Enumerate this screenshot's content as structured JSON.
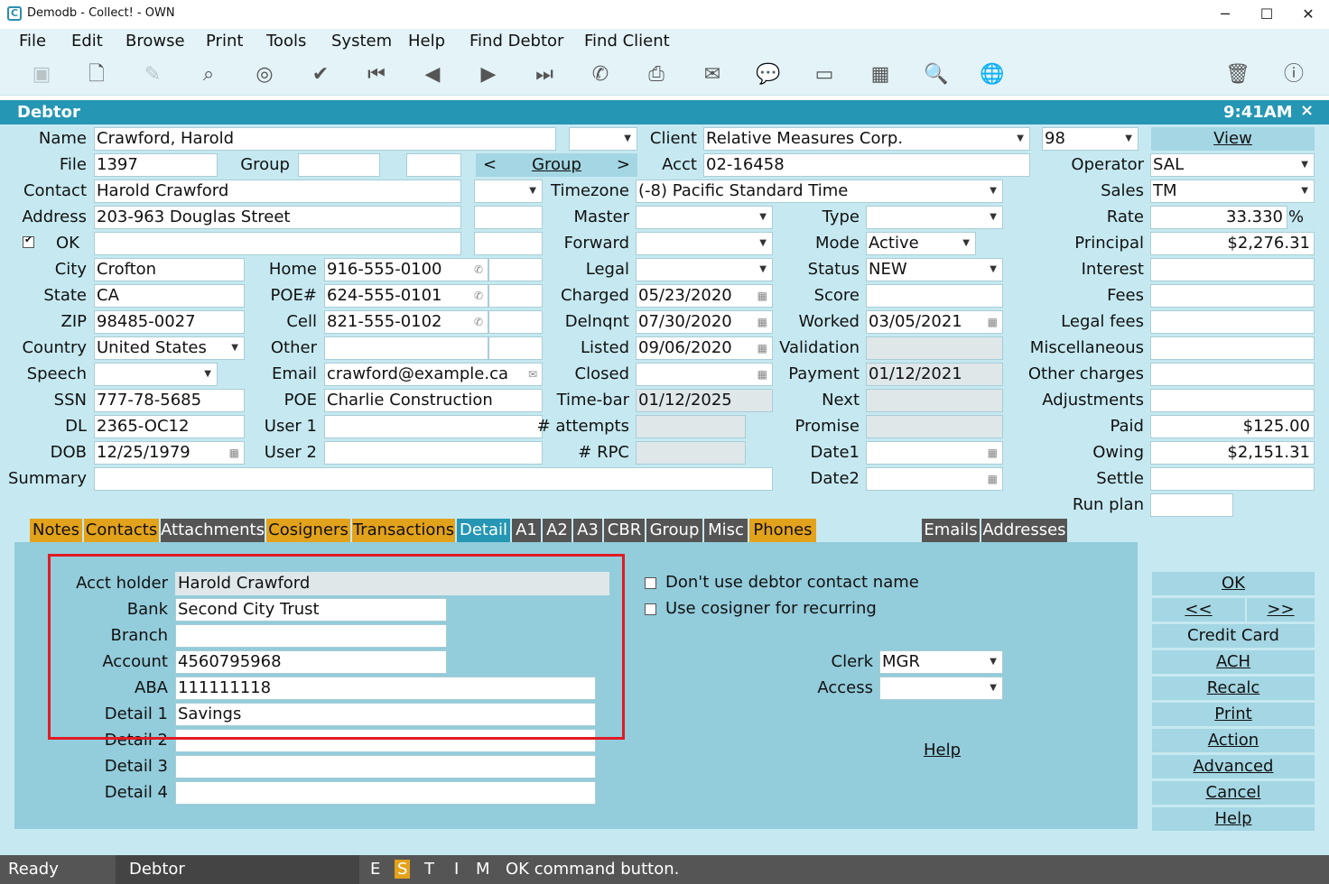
{
  "window": {
    "title": "Demodb - Collect! - OWN",
    "app_icon": "C",
    "min": "─",
    "max": "☐",
    "close": "✕"
  },
  "menu": [
    "File",
    "Edit",
    "Browse",
    "Print",
    "Tools",
    "System",
    "Help",
    "Find Debtor",
    "Find Client"
  ],
  "form": {
    "title": "Debtor",
    "time": "9:41AM",
    "close": "×"
  },
  "labels": {
    "name": "Name",
    "file": "File",
    "group": "Group",
    "contact": "Contact",
    "address": "Address",
    "ok": "OK",
    "city": "City",
    "state": "State",
    "zip": "ZIP",
    "country": "Country",
    "speech": "Speech",
    "ssn": "SSN",
    "dl": "DL",
    "dob": "DOB",
    "summary": "Summary",
    "home": "Home",
    "poe_num": "POE#",
    "cell": "Cell",
    "other": "Other",
    "email": "Email",
    "poe": "POE",
    "user1": "User 1",
    "user2": "User 2",
    "client": "Client",
    "acct": "Acct",
    "timezone": "Timezone",
    "master": "Master",
    "forward": "Forward",
    "legal": "Legal",
    "charged": "Charged",
    "delnqnt": "Delnqnt",
    "listed": "Listed",
    "closed": "Closed",
    "timebar": "Time-bar",
    "attempts": "# attempts",
    "rpc": "# RPC",
    "type": "Type",
    "mode": "Mode",
    "status": "Status",
    "score": "Score",
    "worked": "Worked",
    "validation": "Validation",
    "payment": "Payment",
    "next": "Next",
    "promise": "Promise",
    "date1": "Date1",
    "date2": "Date2",
    "operator": "Operator",
    "sales": "Sales",
    "rate": "Rate",
    "principal": "Principal",
    "interest": "Interest",
    "fees": "Fees",
    "legal_fees": "Legal fees",
    "misc": "Miscellaneous",
    "other_charges": "Other charges",
    "adjustments": "Adjustments",
    "paid": "Paid",
    "owing": "Owing",
    "settle": "Settle",
    "run_plan": "Run plan",
    "pct": "%"
  },
  "values": {
    "name": "Crawford, Harold",
    "file": "1397",
    "contact": "Harold Crawford",
    "address": "203-963 Douglas Street",
    "city": "Crofton",
    "state": "CA",
    "zip": "98485-0027",
    "country": "United States",
    "ssn": "777-78-5685",
    "dl": "2365-OC12",
    "dob": "12/25/1979",
    "home": "916-555-0100",
    "poe_num": "624-555-0101",
    "cell": "821-555-0102",
    "email": "crawford@example.ca",
    "poe": "Charlie Construction",
    "client": "Relative Measures Corp.",
    "client_num": "98",
    "acct": "02-16458",
    "timezone": "(-8) Pacific Standard Time",
    "charged": "05/23/2020",
    "delnqnt": "07/30/2020",
    "listed": "09/06/2020",
    "timebar": "01/12/2025",
    "mode": "Active",
    "status": "NEW",
    "worked": "03/05/2021",
    "payment": "01/12/2021",
    "operator": "SAL",
    "sales": "TM",
    "rate": "33.330",
    "principal": "$2,276.31",
    "paid": "$125.00",
    "owing": "$2,151.31"
  },
  "buttons": {
    "view": "View",
    "group": "Group",
    "group_prev": "<",
    "group_next": ">"
  },
  "tabs": [
    "Notes",
    "Contacts",
    "Attachments",
    "Cosigners",
    "Transactions",
    "Detail",
    "A1",
    "A2",
    "A3",
    "CBR",
    "Group",
    "Misc",
    "Phones",
    "Emails",
    "Addresses"
  ],
  "detail": {
    "labels": [
      "Acct holder",
      "Bank",
      "Branch",
      "Account",
      "ABA",
      "Detail 1",
      "Detail 2",
      "Detail 3",
      "Detail 4"
    ],
    "values": [
      "Harold Crawford",
      "Second City Trust",
      "",
      "4560795968",
      "111111118",
      "Savings",
      "",
      "",
      ""
    ],
    "chk1": "Don't use debtor contact name",
    "chk2": "Use cosigner for recurring",
    "clerk_label": "Clerk",
    "clerk": "MGR",
    "access_label": "Access",
    "help": "Help"
  },
  "side_buttons": {
    "ok": "OK",
    "prev": "<<",
    "next": ">>",
    "credit": "Credit Card",
    "ach": "ACH",
    "recalc": "Recalc",
    "print": "Print",
    "action": "Action",
    "advanced": "Advanced",
    "cancel": "Cancel",
    "help": "Help"
  },
  "statusbar": {
    "ready": "Ready",
    "form": "Debtor",
    "e": "E",
    "s": "S",
    "t": "T",
    "i": "I",
    "m": "M",
    "msg": "OK command button."
  },
  "colors": {
    "accent": "#2596b3",
    "form_bg": "#c6e9f1",
    "panel": "#93ccdb",
    "tab_orange": "#e3a21b",
    "tab_dark": "#555555",
    "highlight": "#e01b24"
  }
}
